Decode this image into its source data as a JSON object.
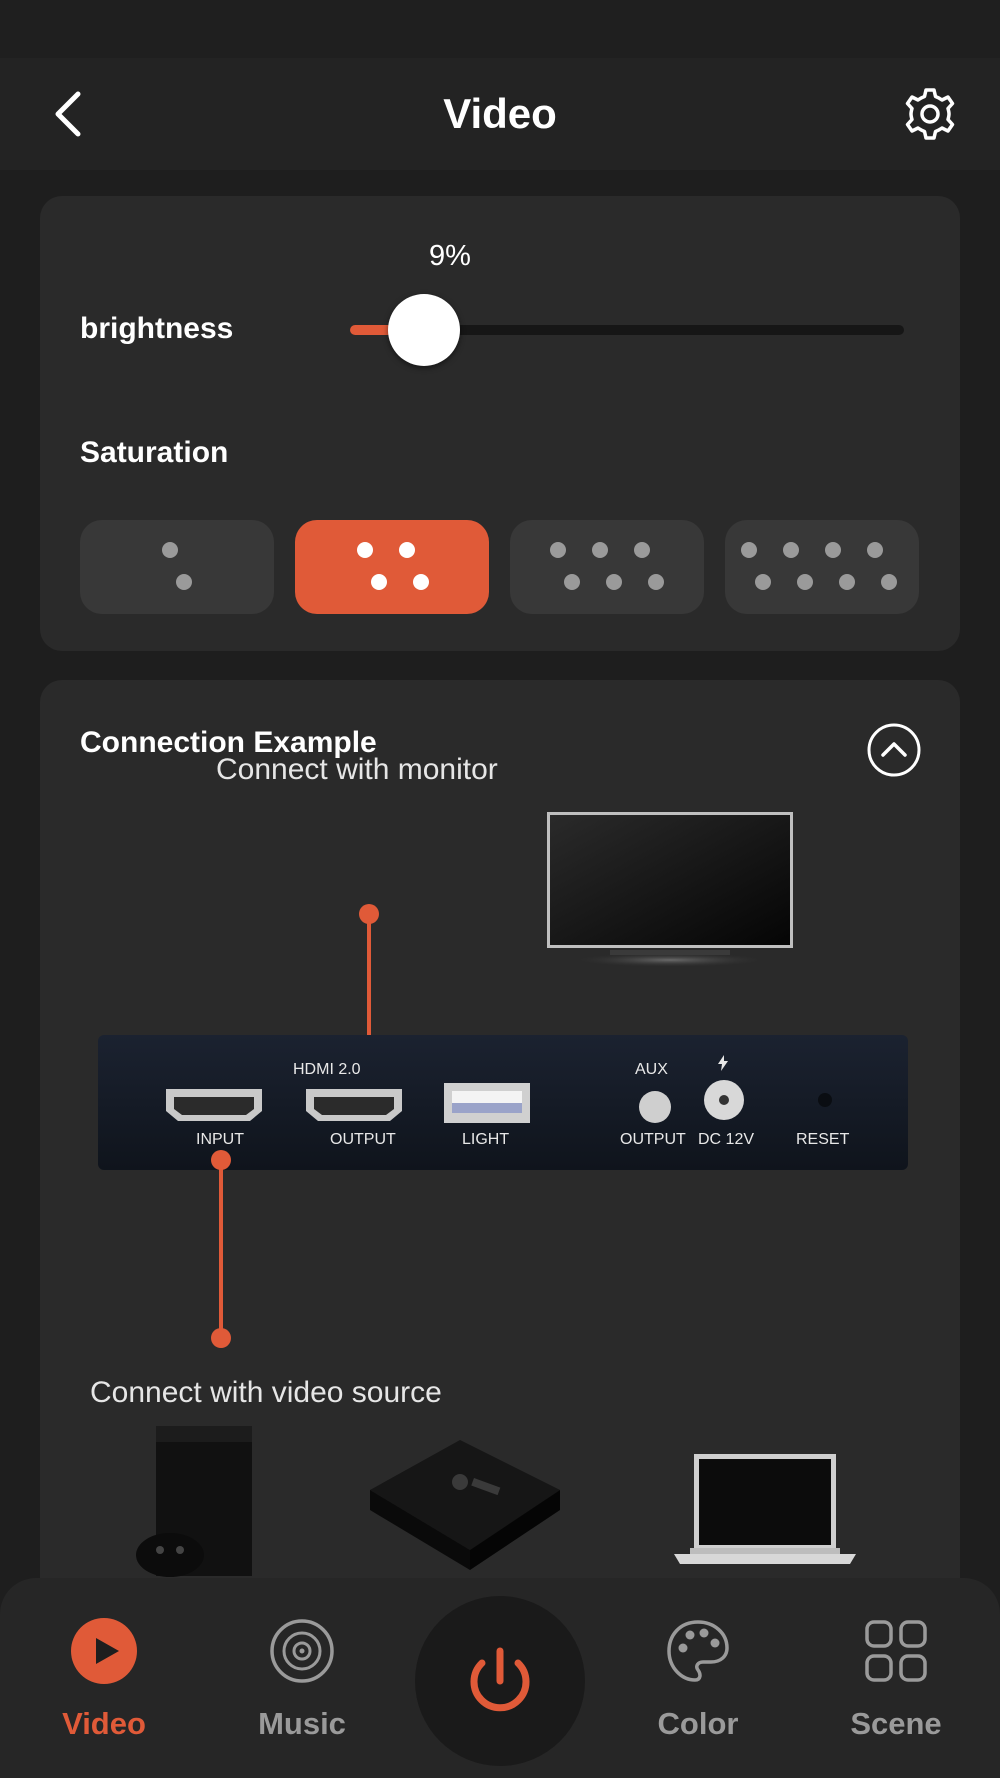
{
  "header": {
    "title": "Video"
  },
  "brightness": {
    "label": "brightness",
    "value_text": "9%",
    "value": 9
  },
  "saturation": {
    "label": "Saturation",
    "options": [
      {
        "level": 1,
        "selected": false
      },
      {
        "level": 2,
        "selected": true
      },
      {
        "level": 3,
        "selected": false
      },
      {
        "level": 4,
        "selected": false
      }
    ]
  },
  "connection": {
    "title": "Connection Example",
    "monitor_caption": "Connect with monitor",
    "source_caption": "Connect with video source",
    "device_ports": {
      "hdmi_header": "HDMI 2.0",
      "input": "INPUT",
      "output": "OUTPUT",
      "light": "LIGHT",
      "aux": "AUX",
      "aux_output": "OUTPUT",
      "dc": "DC 12V",
      "reset": "RESET"
    }
  },
  "nav": {
    "items": [
      {
        "label": "Video",
        "icon": "play-icon",
        "active": true
      },
      {
        "label": "Music",
        "icon": "disc-icon",
        "active": false
      },
      {
        "label": "Color",
        "icon": "palette-icon",
        "active": false
      },
      {
        "label": "Scene",
        "icon": "grid-icon",
        "active": false
      }
    ],
    "power_icon": "power-icon"
  },
  "colors": {
    "accent": "#e05a38",
    "background": "#1e1e1e",
    "card": "#2a2a2a"
  }
}
